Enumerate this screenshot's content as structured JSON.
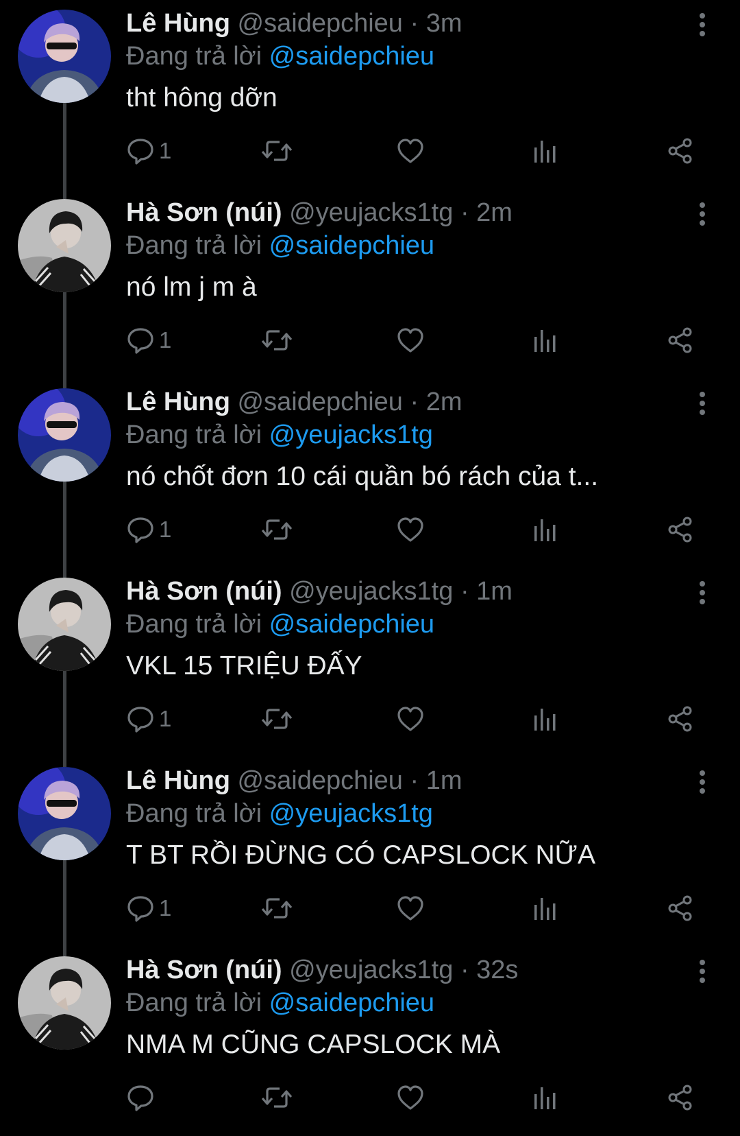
{
  "colors": {
    "background": "#000000",
    "text": "#e7e9ea",
    "muted": "#71767b",
    "mention": "#1d9bf0",
    "thread_line": "#3e4144"
  },
  "reply_prefix": "Đang trả lời",
  "tweets": [
    {
      "name": "Lê Hùng",
      "handle": "@saidepchieu",
      "time": "3m",
      "reply_to": "@saidepchieu",
      "text": "tht hông dỡn",
      "reply_count": "1",
      "avatar": "avatar-le-hung"
    },
    {
      "name": "Hà Sơn (núi)",
      "handle": "@yeujacks1tg",
      "time": "2m",
      "reply_to": "@saidepchieu",
      "text": "nó lm j m à",
      "reply_count": "1",
      "avatar": "avatar-ha-son"
    },
    {
      "name": "Lê Hùng",
      "handle": "@saidepchieu",
      "time": "2m",
      "reply_to": "@yeujacks1tg",
      "text": "nó chốt đơn 10 cái quần bó rách của t...",
      "reply_count": "1",
      "avatar": "avatar-le-hung"
    },
    {
      "name": "Hà Sơn (núi)",
      "handle": "@yeujacks1tg",
      "time": "1m",
      "reply_to": "@saidepchieu",
      "text": "VKL 15 TRIỆU ĐẤY",
      "reply_count": "1",
      "avatar": "avatar-ha-son"
    },
    {
      "name": "Lê Hùng",
      "handle": "@saidepchieu",
      "time": "1m",
      "reply_to": "@yeujacks1tg",
      "text": "T BT RỒI ĐỪNG CÓ CAPSLOCK NỮA",
      "reply_count": "1",
      "avatar": "avatar-le-hung"
    },
    {
      "name": "Hà Sơn (núi)",
      "handle": "@yeujacks1tg",
      "time": "32s",
      "reply_to": "@saidepchieu",
      "text": "NMA M CŨNG CAPSLOCK MÀ",
      "reply_count": "",
      "avatar": "avatar-ha-son"
    }
  ]
}
